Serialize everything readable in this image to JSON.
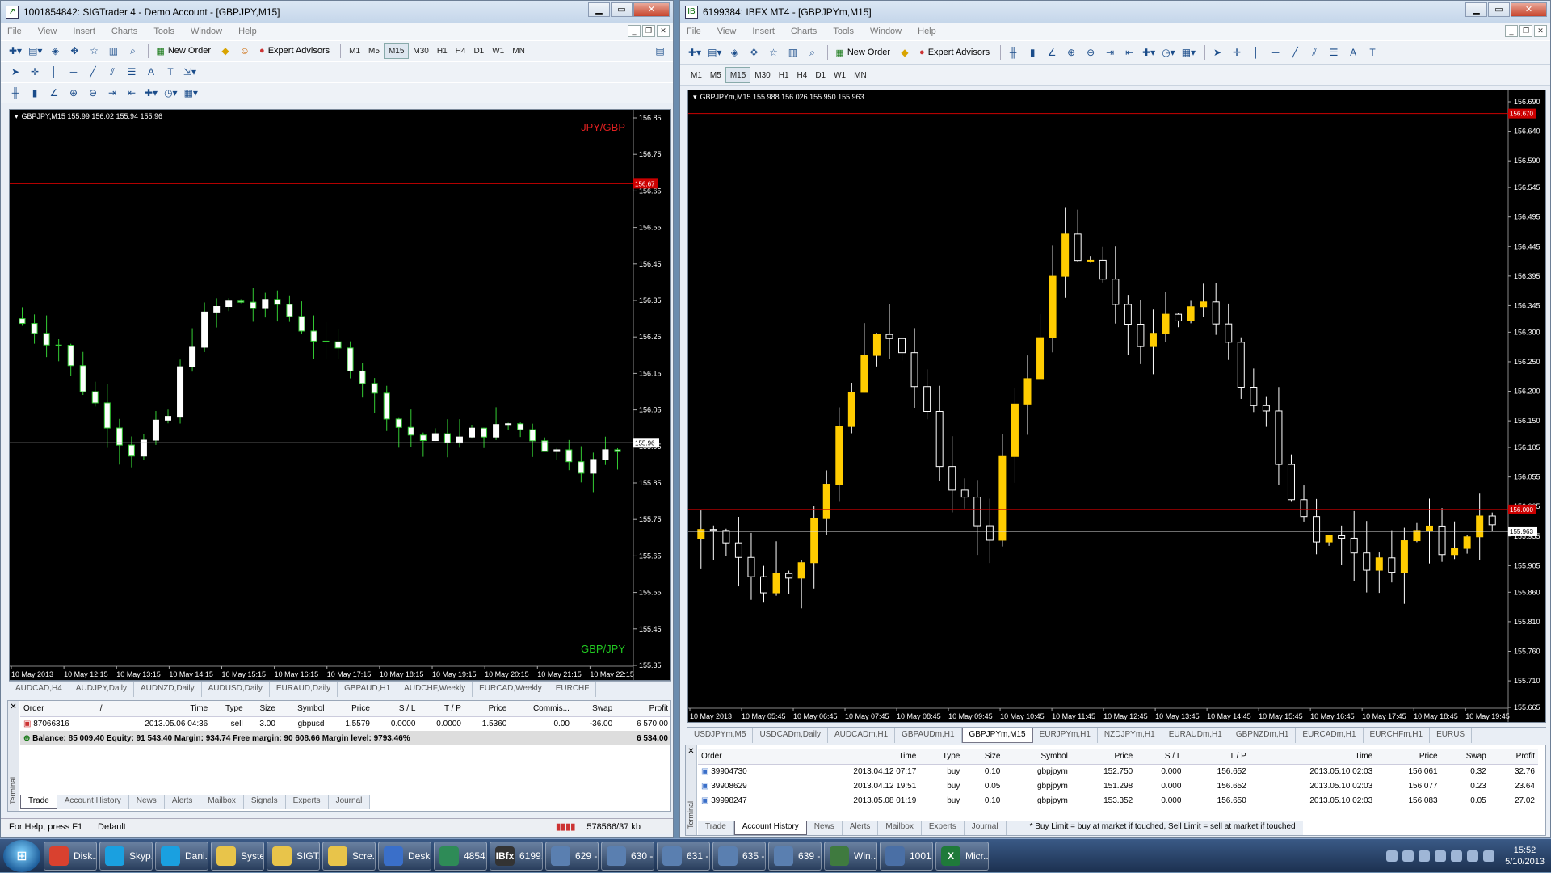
{
  "left": {
    "title": "1001854842: SIGTrader 4 - Demo Account - [GBPJPY,M15]",
    "menu": [
      "File",
      "View",
      "Insert",
      "Charts",
      "Tools",
      "Window",
      "Help"
    ],
    "toolbar": {
      "new_order": "New Order",
      "expert_advisors": "Expert Advisors"
    },
    "timeframes": [
      "M1",
      "M5",
      "M15",
      "M30",
      "H1",
      "H4",
      "D1",
      "W1",
      "MN"
    ],
    "active_tf": "M15",
    "chart": {
      "header": "GBPJPY,M15  155.99 156.02 155.94 155.96",
      "label_top": "JPY/GBP",
      "label_bottom": "GBP/JPY",
      "red_line": "156.67",
      "current": "155.96",
      "y_ticks": [
        "156.85",
        "156.75",
        "156.65",
        "156.55",
        "156.45",
        "156.35",
        "156.25",
        "156.15",
        "156.05",
        "155.95",
        "155.85",
        "155.75",
        "155.65",
        "155.55",
        "155.45",
        "155.35"
      ],
      "x_ticks": [
        "10 May 2013",
        "10 May 12:15",
        "10 May 13:15",
        "10 May 14:15",
        "10 May 15:15",
        "10 May 16:15",
        "10 May 17:15",
        "10 May 18:15",
        "10 May 19:15",
        "10 May 20:15",
        "10 May 21:15",
        "10 May 22:15"
      ],
      "color_up": "#ffffff",
      "color_down": "#ffffff",
      "wick": "#33cc33"
    },
    "symbol_tabs": [
      "AUDCAD,H4",
      "AUDJPY,Daily",
      "AUDNZD,Daily",
      "AUDUSD,Daily",
      "EURAUD,Daily",
      "GBPAUD,H1",
      "AUDCHF,Weekly",
      "EURCAD,Weekly",
      "EURCHF"
    ],
    "columns": [
      "Order",
      "/",
      "Time",
      "Type",
      "Size",
      "Symbol",
      "Price",
      "S / L",
      "T / P",
      "Price",
      "Commis...",
      "Swap",
      "Profit"
    ],
    "rows": [
      [
        "87066316",
        "",
        "2013.05.06 04:36",
        "sell",
        "3.00",
        "gbpusd",
        "1.5579",
        "0.0000",
        "0.0000",
        "1.5360",
        "0.00",
        "-36.00",
        "6 570.00"
      ]
    ],
    "balance_text": "Balance: 85 009.40  Equity: 91 543.40  Margin: 934.74  Free margin: 90 608.66  Margin level: 9793.46%",
    "balance_profit": "6 534.00",
    "term_tabs": [
      "Trade",
      "Account History",
      "News",
      "Alerts",
      "Mailbox",
      "Signals",
      "Experts",
      "Journal"
    ],
    "active_term_tab": "Trade",
    "terminal_label": "Terminal",
    "status": {
      "help": "For Help, press F1",
      "profile": "Default",
      "traffic": "578566/37 kb"
    }
  },
  "right": {
    "title": "6199384: IBFX MT4 - [GBPJPYm,M15]",
    "menu": [
      "File",
      "View",
      "Insert",
      "Charts",
      "Tools",
      "Window",
      "Help"
    ],
    "toolbar": {
      "new_order": "New Order",
      "expert_advisors": "Expert Advisors"
    },
    "timeframes": [
      "M1",
      "M5",
      "M15",
      "M30",
      "H1",
      "H4",
      "D1",
      "W1",
      "MN"
    ],
    "active_tf": "M15",
    "chart": {
      "header": "GBPJPYm,M15  155.988 156.026 155.950 155.963",
      "red_line_top": "156.670",
      "red_line_mid": "156.000",
      "current": "155.963",
      "y_ticks": [
        "156.690",
        "156.640",
        "156.590",
        "156.545",
        "156.495",
        "156.445",
        "156.395",
        "156.345",
        "156.300",
        "156.250",
        "156.200",
        "156.150",
        "156.105",
        "156.055",
        "156.005",
        "155.955",
        "155.905",
        "155.860",
        "155.810",
        "155.760",
        "155.710",
        "155.665"
      ],
      "x_ticks": [
        "10 May 2013",
        "10 May 05:45",
        "10 May 06:45",
        "10 May 07:45",
        "10 May 08:45",
        "10 May 09:45",
        "10 May 10:45",
        "10 May 11:45",
        "10 May 12:45",
        "10 May 13:45",
        "10 May 14:45",
        "10 May 15:45",
        "10 May 16:45",
        "10 May 17:45",
        "10 May 18:45",
        "10 May 19:45"
      ],
      "color_up": "#ffcc00",
      "color_down": "#000000",
      "wick": "#ffffff"
    },
    "symbol_tabs": [
      "USDJPYm,M5",
      "USDCADm,Daily",
      "AUDCADm,H1",
      "GBPAUDm,H1",
      "GBPJPYm,M15",
      "EURJPYm,H1",
      "NZDJPYm,H1",
      "EURAUDm,H1",
      "GBPNZDm,H1",
      "EURCADm,H1",
      "EURCHFm,H1",
      "EURUS"
    ],
    "active_symbol_tab": "GBPJPYm,M15",
    "columns": [
      "Order",
      "Time",
      "Type",
      "Size",
      "Symbol",
      "Price",
      "S / L",
      "T / P",
      "Time",
      "Price",
      "Swap",
      "Profit"
    ],
    "rows": [
      [
        "39904730",
        "2013.04.12 07:17",
        "buy",
        "0.10",
        "gbpjpym",
        "152.750",
        "0.000",
        "156.652",
        "2013.05.10 02:03",
        "156.061",
        "0.32",
        "32.76"
      ],
      [
        "39908629",
        "2013.04.12 19:51",
        "buy",
        "0.05",
        "gbpjpym",
        "151.298",
        "0.000",
        "156.652",
        "2013.05.10 02:03",
        "156.077",
        "0.23",
        "23.64"
      ],
      [
        "39998247",
        "2013.05.08 01:19",
        "buy",
        "0.10",
        "gbpjpym",
        "153.352",
        "0.000",
        "156.650",
        "2013.05.10 02:03",
        "156.083",
        "0.05",
        "27.02"
      ]
    ],
    "term_tabs": [
      "Trade",
      "Account History",
      "News",
      "Alerts",
      "Mailbox",
      "Experts",
      "Journal"
    ],
    "active_term_tab": "Account History",
    "terminal_label": "Terminal",
    "note": "* Buy Limit = buy at market if touched, Sell Limit = sell at market if touched"
  },
  "taskbar": {
    "items": [
      {
        "label": "Disk...",
        "color": "#d9412f"
      },
      {
        "label": "Skyp...",
        "color": "#1aa0e0"
      },
      {
        "label": "Dani...",
        "color": "#1aa0e0"
      },
      {
        "label": "Syste...",
        "color": "#e8c44a"
      },
      {
        "label": "SIGT...",
        "color": "#e8c44a"
      },
      {
        "label": "Scre...",
        "color": "#e8c44a"
      },
      {
        "label": "Desk...",
        "color": "#3a6fc9"
      },
      {
        "label": "4854...",
        "color": "#2e8b57"
      },
      {
        "label": "6199...",
        "color": "#333333",
        "icon_text": "IBfx"
      },
      {
        "label": "629 -...",
        "color": "#5a7fb0"
      },
      {
        "label": "630 -...",
        "color": "#5a7fb0"
      },
      {
        "label": "631 -...",
        "color": "#5a7fb0"
      },
      {
        "label": "635 -...",
        "color": "#5a7fb0"
      },
      {
        "label": "639 -...",
        "color": "#5a7fb0"
      },
      {
        "label": "Win...",
        "color": "#3f7a3f"
      },
      {
        "label": "1001...",
        "color": "#4a6fa5"
      },
      {
        "label": "Micr...",
        "color": "#1f7a3a",
        "icon_text": "X"
      }
    ],
    "time": "15:52",
    "date": "5/10/2013"
  }
}
